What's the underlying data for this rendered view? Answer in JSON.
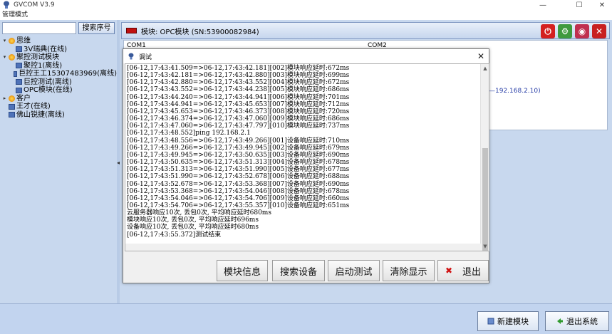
{
  "window": {
    "title": "GVCOM  V3.9",
    "minimize": "—",
    "maximize": "☐",
    "close": "✕"
  },
  "menu": {
    "mode_label": "管理模式"
  },
  "sidebar": {
    "search_placeholder": "",
    "search_button": "搜索序号",
    "tree": [
      {
        "label": "思维",
        "level": 0,
        "kind": "group",
        "expander": "▾"
      },
      {
        "label": "3V瑞典(在线)",
        "level": 1,
        "kind": "device",
        "expander": ""
      },
      {
        "label": "聚控测试模块",
        "level": 0,
        "kind": "group",
        "expander": "▾"
      },
      {
        "label": "聚控1(离线)",
        "level": 1,
        "kind": "device",
        "expander": ""
      },
      {
        "label": "巨控王工15307483969(离线)",
        "level": 1,
        "kind": "device",
        "expander": ""
      },
      {
        "label": "巨控测试(离线)",
        "level": 1,
        "kind": "device",
        "expander": ""
      },
      {
        "label": "OPC模块(在线)",
        "level": 1,
        "kind": "device",
        "expander": ""
      },
      {
        "label": "客户",
        "level": 0,
        "kind": "group",
        "expander": "▸"
      },
      {
        "label": "王才(在线)",
        "level": 0,
        "kind": "device",
        "expander": ""
      },
      {
        "label": "佛山锐捷(离线)",
        "level": 0,
        "kind": "device",
        "expander": ""
      }
    ]
  },
  "module_header": {
    "title": "模块: OPC模块 (SN:53900082984)"
  },
  "grid": {
    "col1": "COM1",
    "col2": "COM2",
    "ip_value": "—192.168.2.10)"
  },
  "dialog": {
    "title": "调试",
    "close": "✕",
    "log": [
      "[06-12,17:43:41.509=>06-12,17:43:42.181][002]模块响应延时:672ms",
      "[06-12,17:43:42.181=>06-12,17:43:42.880][003]模块响应延时:699ms",
      "[06-12,17:43:42.880=>06-12,17:43:43.552][004]模块响应延时:672ms",
      "[06-12,17:43:43.552=>06-12,17:43:44.238][005]模块响应延时:686ms",
      "[06-12,17:43:44.240=>06-12,17:43:44.941][006]模块响应延时:701ms",
      "[06-12,17:43:44.941=>06-12,17:43:45.653][007]模块响应延时:712ms",
      "[06-12,17:43:45.653=>06-12,17:43:46.373][008]模块响应延时:720ms",
      "[06-12,17:43:46.374=>06-12,17:43:47.060][009]模块响应延时:686ms",
      "[06-12,17:43:47.060=>06-12,17:43:47.797][010]模块响应延时:737ms",
      "[06-12,17:43:48.552]ping 192.168.2.1",
      "[06-12,17:43:48.556=>06-12,17:43:49.266][001]设备响应延时:710ms",
      "[06-12,17:43:49.266=>06-12,17:43:49.945][002]设备响应延时:679ms",
      "[06-12,17:43:49.945=>06-12,17:43:50.635][003]设备响应延时:690ms",
      "[06-12,17:43:50.635=>06-12,17:43:51.313][004]设备响应延时:678ms",
      "[06-12,17:43:51.313=>06-12,17:43:51.990][005]设备响应延时:677ms",
      "[06-12,17:43:51.990=>06-12,17:43:52.678][006]设备响应延时:688ms",
      "[06-12,17:43:52.678=>06-12,17:43:53.368][007]设备响应延时:690ms",
      "[06-12,17:43:53.368=>06-12,17:43:54.046][008]设备响应延时:678ms",
      "[06-12,17:43:54.046=>06-12,17:43:54.706][009]设备响应延时:660ms",
      "[06-12,17:43:54.706=>06-12,17:43:55.357][010]设备响应延时:651ms",
      "云服务器响应10次, 丢包0次, 平均响应延时680ms",
      "模块响应10次, 丢包0次, 平均响应延时696ms",
      "设备响应10次, 丢包0次, 平均响应延时680ms",
      "[06-12,17:43:55.372]测试结束"
    ],
    "buttons": {
      "module_info": "模块信息",
      "search_device": "搜索设备",
      "start_test": "启动测试",
      "clear_display": "清除显示",
      "exit": "退出",
      "exit_icon": "✖"
    }
  },
  "bottom": {
    "new_module": "新建模块",
    "exit_system": "退出系统"
  },
  "colors": {
    "background": "#c9d9ee",
    "flag": "#c01010",
    "power_button": "#d42020",
    "settings_button": "#3f9a3f",
    "link_button": "#c03050",
    "close_button": "#c82020",
    "ip_text": "#2a40a8"
  }
}
